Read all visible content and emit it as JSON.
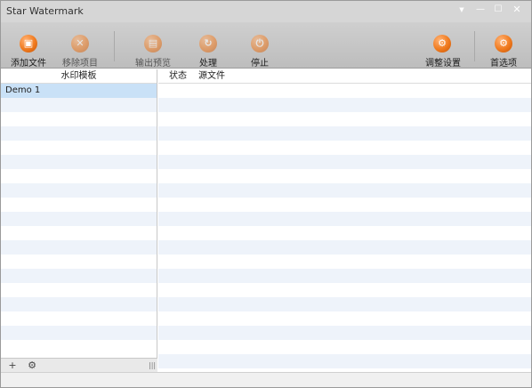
{
  "window": {
    "title": "Star Watermark"
  },
  "toolbar": {
    "add_file": "添加文件",
    "remove_item": "移除项目",
    "output_preview": "输出预览",
    "process": "处理",
    "stop": "停止",
    "adjust_settings": "调整设置",
    "preferences": "首选项"
  },
  "icons": {
    "add_file": "add-file-icon",
    "remove_item": "remove-icon",
    "output_preview": "preview-icon",
    "process": "process-icon",
    "stop": "stop-icon",
    "adjust_settings": "settings-icon",
    "preferences": "preferences-icon",
    "accent": "#f07a1e"
  },
  "left_panel": {
    "header": "水印模板",
    "items": [
      "Demo 1"
    ],
    "footer": {
      "add_symbol": "+",
      "gear_symbol": "⚙"
    }
  },
  "right_panel": {
    "columns": [
      "状态",
      "源文件"
    ],
    "rows": []
  }
}
